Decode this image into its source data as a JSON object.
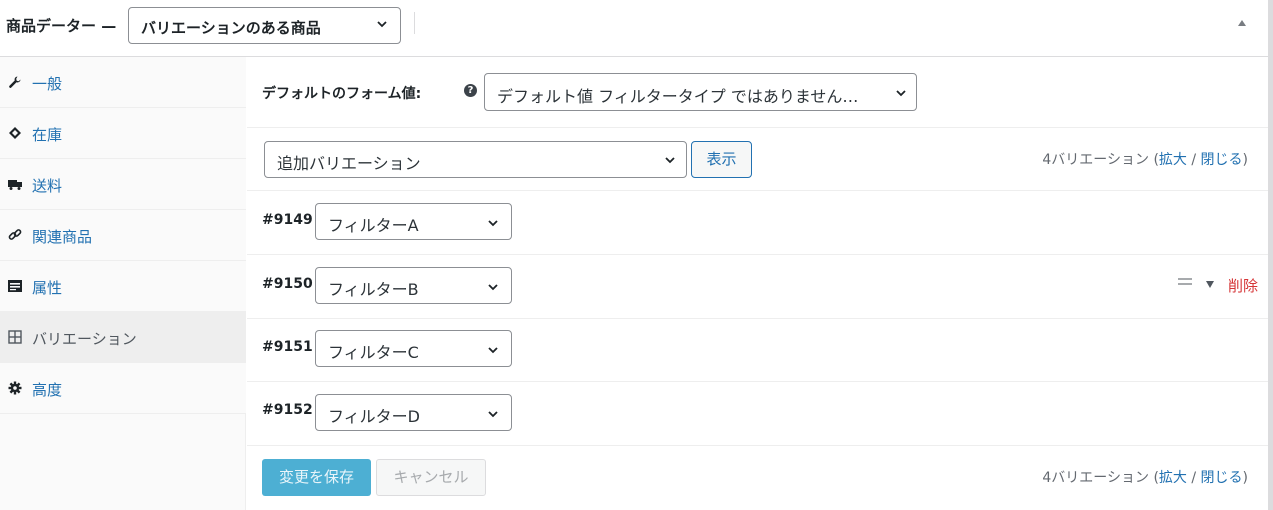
{
  "header": {
    "title": "商品データー",
    "product_type": "バリエーションのある商品"
  },
  "sidebar": {
    "items": [
      {
        "label": "一般",
        "icon": "wrench-icon"
      },
      {
        "label": "在庫",
        "icon": "tag-icon"
      },
      {
        "label": "送料",
        "icon": "truck-icon"
      },
      {
        "label": "関連商品",
        "icon": "link-icon"
      },
      {
        "label": "属性",
        "icon": "list-icon"
      },
      {
        "label": "バリエーション",
        "icon": "grid-icon",
        "active": true
      },
      {
        "label": "高度",
        "icon": "gear-icon"
      }
    ]
  },
  "defaults": {
    "label": "デフォルトのフォーム値:",
    "help": "?",
    "value": "デフォルト値 フィルタータイプ ではありません…"
  },
  "toolbar": {
    "action_value": "追加バリエーション",
    "show_label": "表示"
  },
  "summary": {
    "count_text": "4バリエーション",
    "open_paren": "(",
    "expand": "拡大",
    "slash": "/",
    "close": "閉じる",
    "close_paren": ")"
  },
  "variations": [
    {
      "id": "#9149",
      "value": "フィルターA"
    },
    {
      "id": "#9150",
      "value": "フィルターB"
    },
    {
      "id": "#9151",
      "value": "フィルターC"
    },
    {
      "id": "#9152",
      "value": "フィルターD"
    }
  ],
  "row_actions": {
    "remove_label": "削除"
  },
  "footer": {
    "save_label": "変更を保存",
    "cancel_label": "キャンセル"
  },
  "colors": {
    "link": "#2271b1",
    "danger": "#d63638",
    "primary": "#2ea2cc",
    "active_bg": "#eeeeee"
  }
}
